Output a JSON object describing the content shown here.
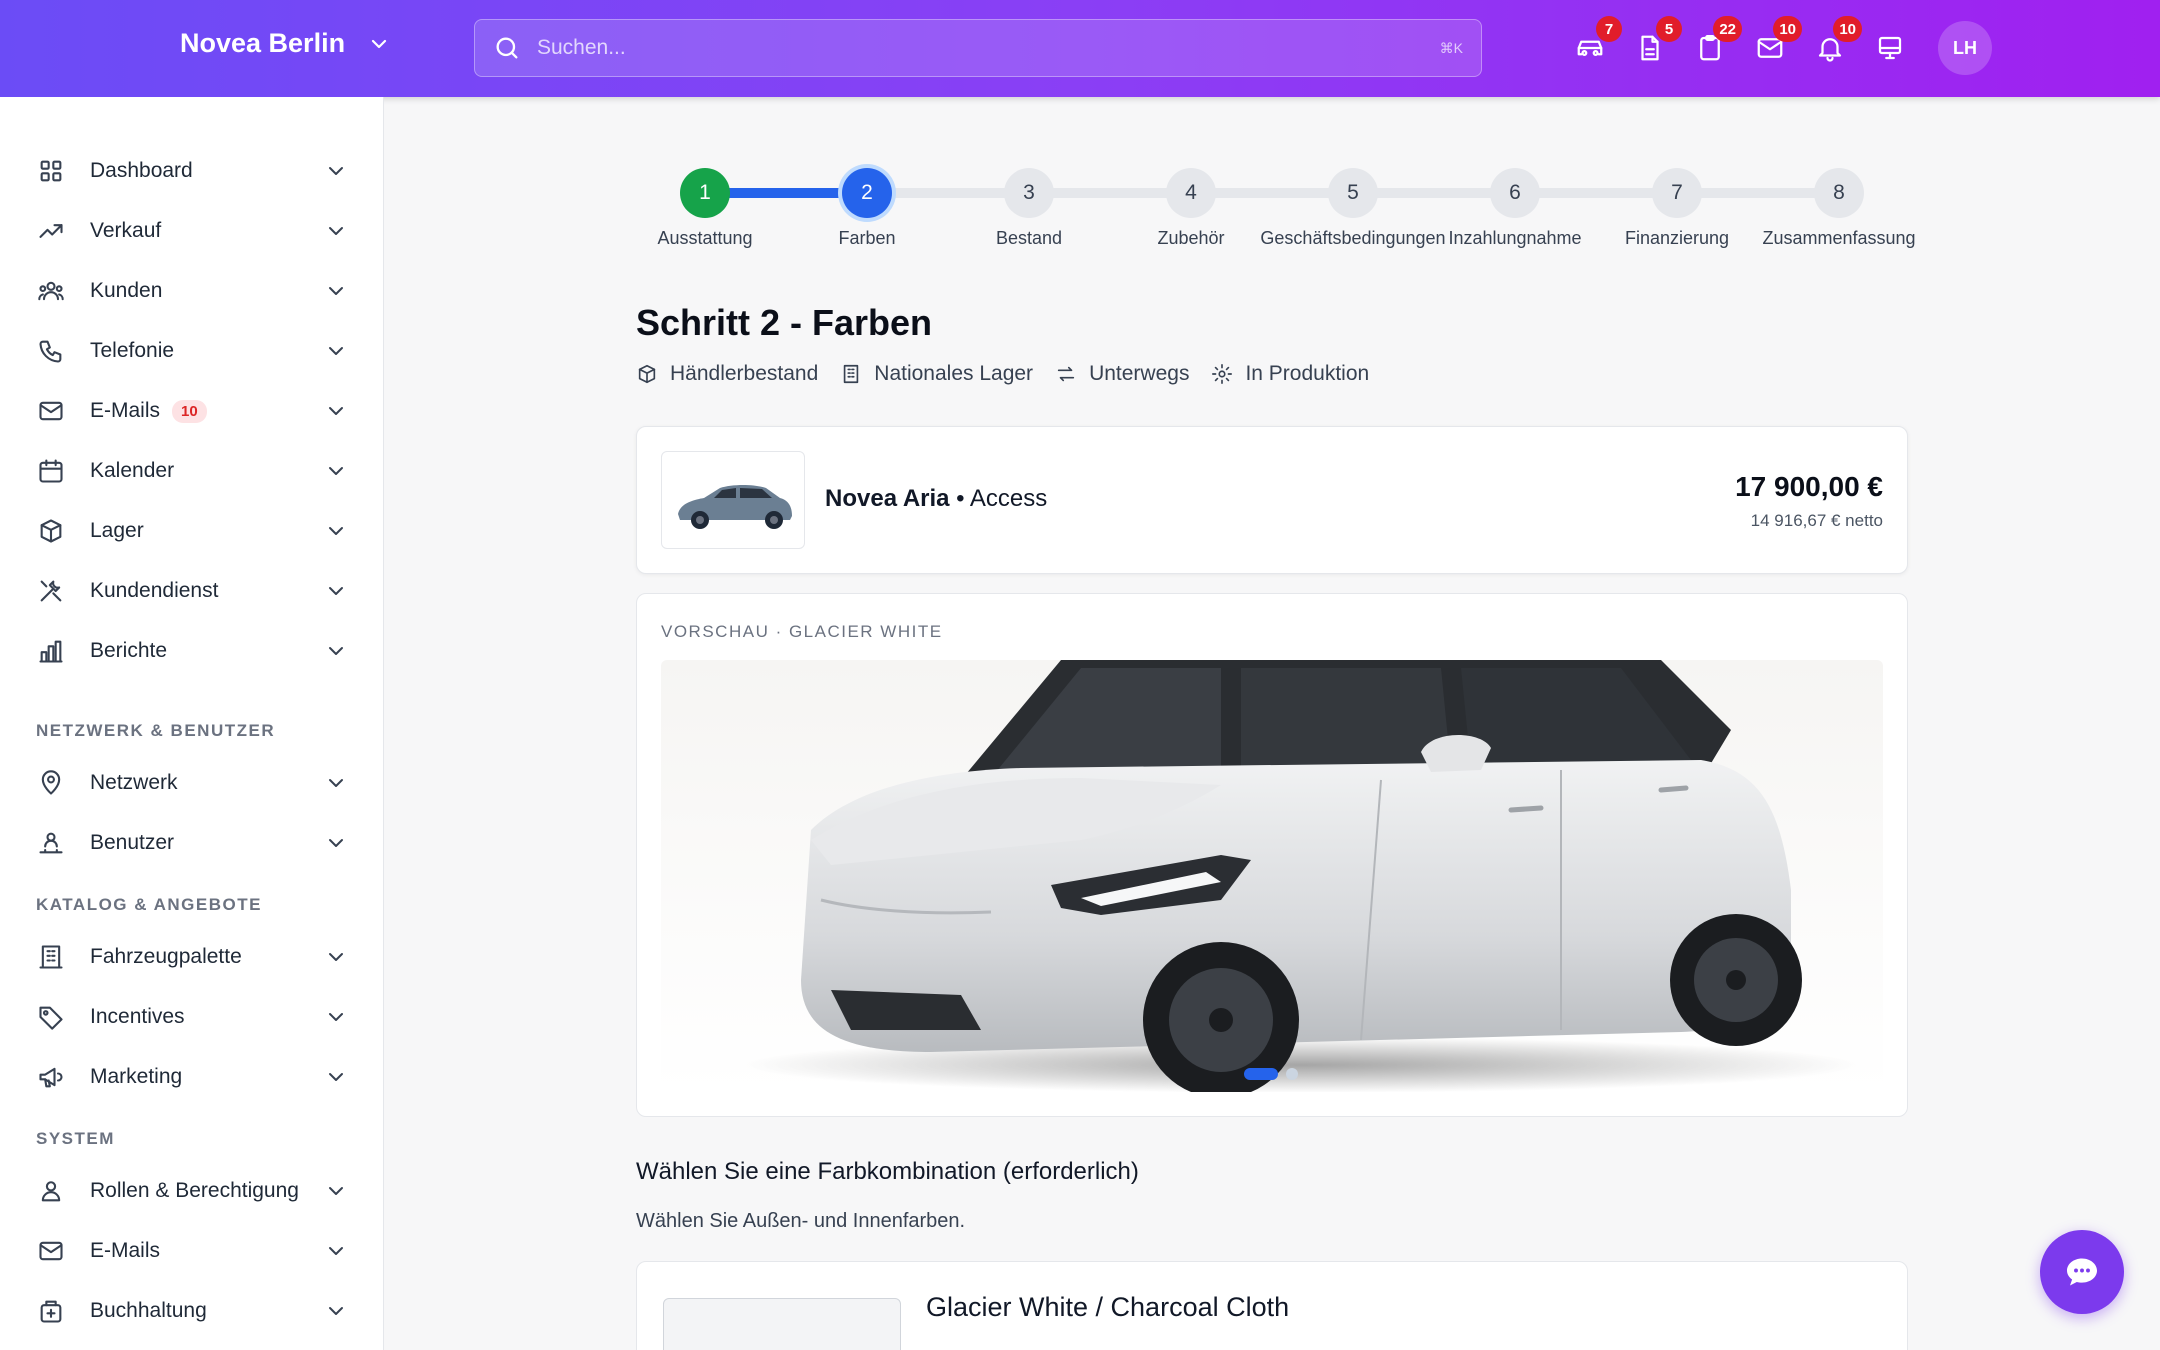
{
  "header": {
    "brand": "Novea Berlin",
    "search_placeholder": "Suchen...",
    "search_shortcut": "⌘K",
    "icons": [
      {
        "name": "car-icon",
        "badge": "7"
      },
      {
        "name": "document-icon",
        "badge": "5"
      },
      {
        "name": "clipboard-icon",
        "badge": "22"
      },
      {
        "name": "mail-icon",
        "badge": "10"
      },
      {
        "name": "bell-icon",
        "badge": "10"
      },
      {
        "name": "monitor-icon",
        "badge": ""
      }
    ],
    "avatar": "LH"
  },
  "sidebar": {
    "items": [
      {
        "label": "Dashboard",
        "icon": "grid-icon"
      },
      {
        "label": "Verkauf",
        "icon": "trending-up-icon"
      },
      {
        "label": "Kunden",
        "icon": "users-icon"
      },
      {
        "label": "Telefonie",
        "icon": "phone-icon"
      },
      {
        "label": "E-Mails",
        "icon": "mail-icon",
        "badge": "10"
      },
      {
        "label": "Kalender",
        "icon": "calendar-icon"
      },
      {
        "label": "Lager",
        "icon": "box-icon"
      },
      {
        "label": "Kundendienst",
        "icon": "tools-icon"
      },
      {
        "label": "Berichte",
        "icon": "bar-chart-icon"
      }
    ],
    "section_network": "NETZWERK & BENUTZER",
    "network_items": [
      {
        "label": "Netzwerk",
        "icon": "map-pin-icon"
      },
      {
        "label": "Benutzer",
        "icon": "user-network-icon"
      }
    ],
    "section_catalog": "KATALOG & ANGEBOTE",
    "catalog_items": [
      {
        "label": "Fahrzeugpalette",
        "icon": "building-icon"
      },
      {
        "label": "Incentives",
        "icon": "tag-icon"
      },
      {
        "label": "Marketing",
        "icon": "megaphone-icon"
      }
    ],
    "section_system": "SYSTEM",
    "system_items": [
      {
        "label": "Rollen & Berechtigung",
        "icon": "user-icon"
      },
      {
        "label": "E-Mails",
        "icon": "mail-icon"
      },
      {
        "label": "Buchhaltung",
        "icon": "wallet-icon"
      }
    ]
  },
  "stepper": {
    "steps": [
      {
        "num": "1",
        "label": "Ausstattung",
        "state": "done"
      },
      {
        "num": "2",
        "label": "Farben",
        "state": "active"
      },
      {
        "num": "3",
        "label": "Bestand",
        "state": "todo"
      },
      {
        "num": "4",
        "label": "Zubehör",
        "state": "todo"
      },
      {
        "num": "5",
        "label": "Geschäftsbedingungen",
        "state": "todo"
      },
      {
        "num": "6",
        "label": "Inzahlungnahme",
        "state": "todo"
      },
      {
        "num": "7",
        "label": "Finanzierung",
        "state": "todo"
      },
      {
        "num": "8",
        "label": "Zusammenfassung",
        "state": "todo"
      }
    ],
    "progress": 0.143
  },
  "main": {
    "title": "Schritt 2 - Farben",
    "stock_tabs": [
      {
        "label": "Händlerbestand",
        "icon": "cube-icon"
      },
      {
        "label": "Nationales Lager",
        "icon": "building-icon"
      },
      {
        "label": "Unterwegs",
        "icon": "arrows-exchange-icon"
      },
      {
        "label": "In Produktion",
        "icon": "gear-icon"
      }
    ],
    "model": {
      "name": "Novea Aria",
      "separator": " • ",
      "trim": "Access",
      "price": "17 900,00 €",
      "netto": "14 916,67 € netto"
    },
    "preview_label": "VORSCHAU · GLACIER WHITE",
    "carousel": {
      "count": 2,
      "active": 0
    },
    "color_heading": "Wählen Sie eine Farbkombination (erforderlich)",
    "color_subtext": "Wählen Sie Außen- und Innenfarben.",
    "combo_title": "Glacier White / Charcoal Cloth"
  },
  "colors": {
    "accent": "#2563eb",
    "done": "#16a34a",
    "badge": "#e11d2a",
    "header_from": "#6b4cf6",
    "header_to": "#a020f0"
  }
}
